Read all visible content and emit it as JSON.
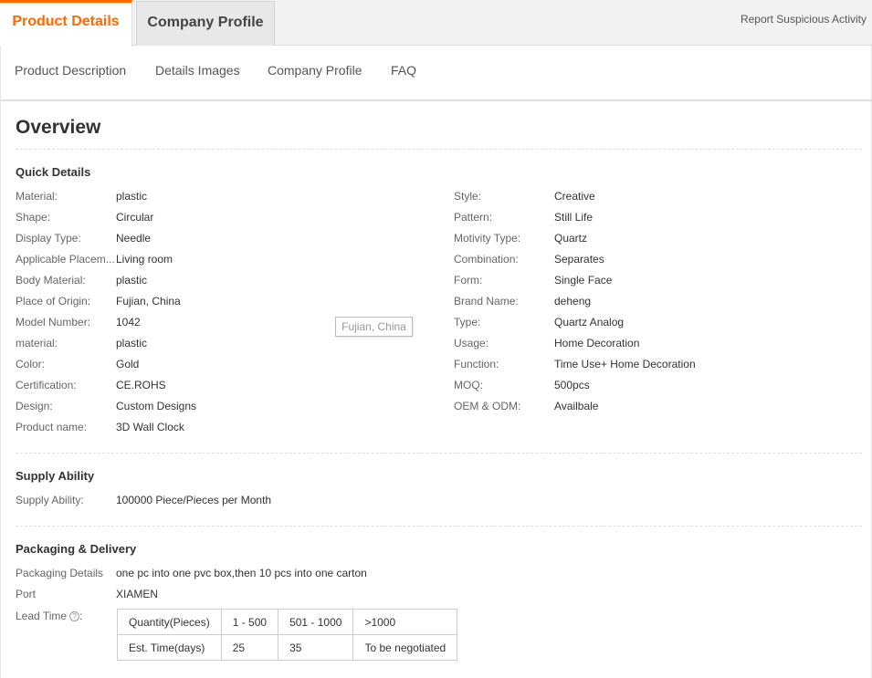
{
  "tabs": {
    "active": "Product Details",
    "inactive": "Company Profile",
    "report": "Report Suspicious Activity"
  },
  "subnav": [
    "Product Description",
    "Details Images",
    "Company Profile",
    "FAQ"
  ],
  "overview_title": "Overview",
  "quick_details": {
    "title": "Quick Details",
    "left": [
      {
        "k": "Material:",
        "v": "plastic"
      },
      {
        "k": "Shape:",
        "v": "Circular"
      },
      {
        "k": "Display Type:",
        "v": "Needle"
      },
      {
        "k": "Applicable Placem...",
        "v": "Living room"
      },
      {
        "k": "Body Material:",
        "v": "plastic"
      },
      {
        "k": "Place of Origin:",
        "v": "Fujian, China"
      },
      {
        "k": "Model Number:",
        "v": "1042"
      },
      {
        "k": "material:",
        "v": "plastic"
      },
      {
        "k": "Color:",
        "v": "Gold"
      },
      {
        "k": "Certification:",
        "v": "CE.ROHS"
      },
      {
        "k": "Design:",
        "v": "Custom Designs"
      },
      {
        "k": "Product name:",
        "v": "3D Wall Clock"
      }
    ],
    "right": [
      {
        "k": "Style:",
        "v": "Creative"
      },
      {
        "k": "Pattern:",
        "v": "Still Life"
      },
      {
        "k": "Motivity Type:",
        "v": "Quartz"
      },
      {
        "k": "Combination:",
        "v": "Separates"
      },
      {
        "k": "Form:",
        "v": "Single Face"
      },
      {
        "k": "Brand Name:",
        "v": "deheng"
      },
      {
        "k": "Type:",
        "v": "Quartz Analog"
      },
      {
        "k": "Usage:",
        "v": "Home Decoration"
      },
      {
        "k": "Function:",
        "v": "Time Use+ Home Decoration"
      },
      {
        "k": "MOQ:",
        "v": "500pcs"
      },
      {
        "k": "OEM & ODM:",
        "v": "Availbale"
      }
    ],
    "tooltip": "Fujian, China"
  },
  "supply": {
    "title": "Supply Ability",
    "k": "Supply Ability:",
    "v": "100000 Piece/Pieces per Month"
  },
  "packaging": {
    "title": "Packaging & Delivery",
    "details_k": "Packaging Details",
    "details_v": "one pc into one pvc box,then 10 pcs into one carton",
    "port_k": "Port",
    "port_v": "XIAMEN",
    "lead_k": "Lead Time",
    "lead_help": "?",
    "lead_table": [
      [
        "Quantity(Pieces)",
        "1 - 500",
        "501 - 1000",
        ">1000"
      ],
      [
        "Est. Time(days)",
        "25",
        "35",
        "To be negotiated"
      ]
    ]
  }
}
